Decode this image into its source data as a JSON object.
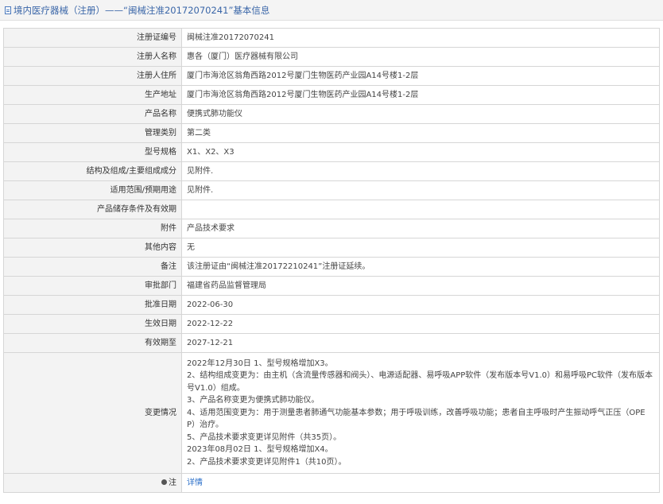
{
  "header": {
    "title": "境内医疗器械（注册）——“闽械注准20172070241”基本信息"
  },
  "fields": [
    {
      "label": "注册证编号",
      "value": "闽械注准20172070241"
    },
    {
      "label": "注册人名称",
      "value": "惠各（厦门）医疗器械有限公司"
    },
    {
      "label": "注册人住所",
      "value": "厦门市海沧区翁角西路2012号厦门生物医药产业园A14号楼1-2层"
    },
    {
      "label": "生产地址",
      "value": "厦门市海沧区翁角西路2012号厦门生物医药产业园A14号楼1-2层"
    },
    {
      "label": "产品名称",
      "value": "便携式肺功能仪"
    },
    {
      "label": "管理类别",
      "value": "第二类"
    },
    {
      "label": "型号规格",
      "value": "X1、X2、X3"
    },
    {
      "label": "结构及组成/主要组成成分",
      "value": "见附件."
    },
    {
      "label": "适用范围/预期用途",
      "value": "见附件."
    },
    {
      "label": "产品储存条件及有效期",
      "value": ""
    },
    {
      "label": "附件",
      "value": "产品技术要求"
    },
    {
      "label": "其他内容",
      "value": "无"
    },
    {
      "label": "备注",
      "value": "该注册证由“闽械注准20172210241”注册证延续。"
    },
    {
      "label": "审批部门",
      "value": "福建省药品监督管理局"
    },
    {
      "label": "批准日期",
      "value": "2022-06-30"
    },
    {
      "label": "生效日期",
      "value": "2022-12-22"
    },
    {
      "label": "有效期至",
      "value": "2027-12-21"
    }
  ],
  "changes": {
    "label": "变更情况",
    "lines": [
      "2022年12月30日 1、型号规格增加X3。",
      "2、结构组成变更为：由主机（含流量传感器和阀头）、电源适配器、易呼吸APP软件（发布版本号V1.0）和易呼吸PC软件（发布版本",
      "号V1.0）组成。",
      "3、产品名称变更为便携式肺功能仪。",
      "4、适用范围变更为：用于测量患者肺通气功能基本参数；用于呼吸训练，改善呼吸功能；患者自主呼吸时产生振动呼气正压（OPE",
      "P）治疗。",
      "5、产品技术要求变更详见附件（共35页）。",
      "2023年08月02日 1、型号规格增加X4。",
      "2、产品技术要求变更详见附件1（共10页）。"
    ]
  },
  "note": {
    "label": "注",
    "icon": "note-dot-icon",
    "link_text": "详情"
  }
}
